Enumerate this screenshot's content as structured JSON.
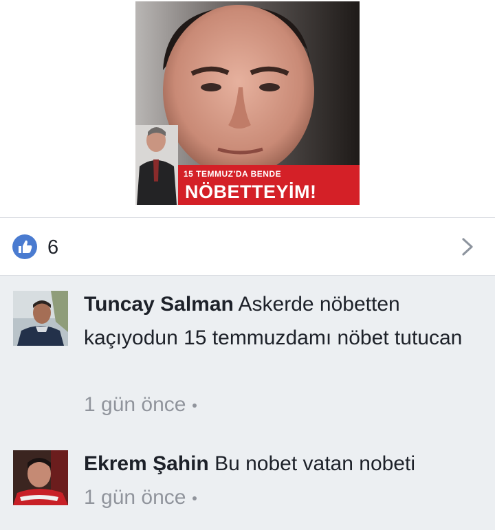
{
  "post": {
    "image": {
      "banner_line1": "15 TEMMUZ'DA BENDE",
      "banner_line2": "NÖBETTEYİM!",
      "banner_color": "#d42027"
    }
  },
  "reactions": {
    "icon": "thumbs-up-icon",
    "count": "6",
    "accent": "#4a7bd0"
  },
  "comments": [
    {
      "author": "Tuncay Salman",
      "text": "Askerde nöbetten kaçıyodun 15 temmuzdamı nöbet tutucan",
      "time": "1 gün önce"
    },
    {
      "author": "Ekrem Şahin",
      "text": "Bu nobet vatan nobeti",
      "time": "1 gün önce"
    }
  ]
}
